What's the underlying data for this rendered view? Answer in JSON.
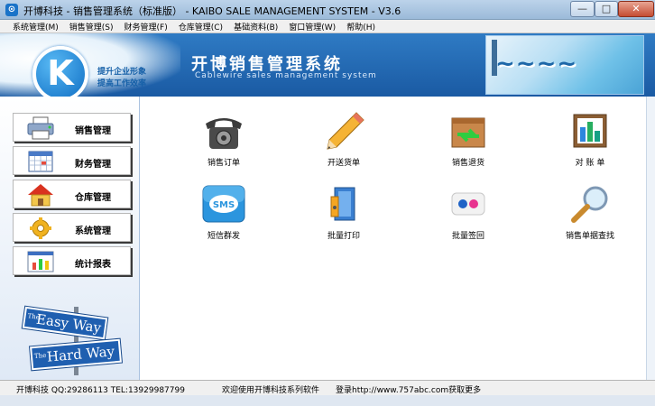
{
  "window": {
    "title": "开博科技 - 销售管理系统（标准版） - KAIBO SALE MANAGEMENT SYSTEM - V3.6",
    "min_label": "—",
    "max_label": "□",
    "close_label": "✕"
  },
  "menu": [
    {
      "label": "系统管理(M)"
    },
    {
      "label": "销售管理(S)"
    },
    {
      "label": "财务管理(F)"
    },
    {
      "label": "仓库管理(C)"
    },
    {
      "label": "基础资料(B)"
    },
    {
      "label": "窗口管理(W)"
    },
    {
      "label": "帮助(H)"
    }
  ],
  "banner": {
    "logo_letter": "K",
    "slogan1": "提升企业形象",
    "slogan2": "提高工作效率",
    "title": "开博销售管理系统",
    "subtitle": "Cablewire sales management system"
  },
  "sidebar": {
    "items": [
      {
        "label": "销售管理",
        "icon": "printer-icon"
      },
      {
        "label": "财务管理",
        "icon": "calendar-icon"
      },
      {
        "label": "仓库管理",
        "icon": "house-icon"
      },
      {
        "label": "系统管理",
        "icon": "gear-icon"
      },
      {
        "label": "统计报表",
        "icon": "bar-chart-icon"
      }
    ],
    "sign_easy": "Easy Way",
    "sign_hard": "Hard Way",
    "sign_the": "The"
  },
  "features": [
    {
      "label": "销售订单",
      "icon": "telephone-icon"
    },
    {
      "label": "开送货单",
      "icon": "pencil-icon"
    },
    {
      "label": "销售退货",
      "icon": "return-box-icon"
    },
    {
      "label": "对 账 单",
      "icon": "statement-chart-icon"
    },
    {
      "label": "短信群发",
      "icon": "sms-icon"
    },
    {
      "label": "批量打印",
      "icon": "print-folder-icon"
    },
    {
      "label": "批量签回",
      "icon": "sign-back-icon"
    },
    {
      "label": "销售单据查找",
      "icon": "magnifier-icon"
    }
  ],
  "status": {
    "company": "开博科技  QQ:29286113  TEL:13929987799",
    "welcome": "欢迎使用开博科技系列软件",
    "website": "登录http://www.757abc.com获取更多"
  },
  "colors": {
    "banner_blue": "#1a5aa3",
    "sidebar_bg": "#dfe9f6"
  }
}
